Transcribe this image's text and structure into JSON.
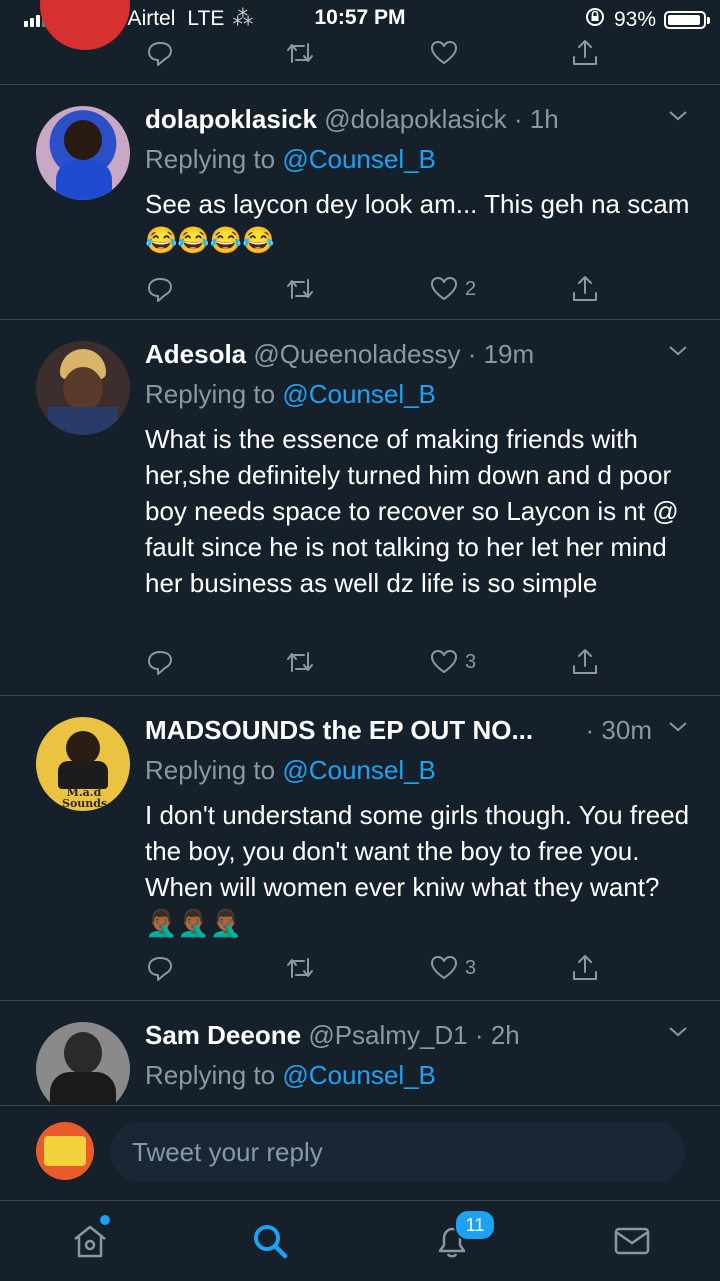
{
  "status_bar": {
    "carrier": "BeSafe Airtel",
    "network": "LTE",
    "time": "10:57 PM",
    "battery": "93%",
    "battery_level": 0.93
  },
  "tweets": [
    {
      "name": "dolapoklasick",
      "handle": "@dolapoklasick",
      "time": "· 1h",
      "replying_prefix": "Replying to",
      "replying_to": "@Counsel_B",
      "text": "See as laycon dey look am... This geh na scam 😂😂😂😂",
      "likes": "2"
    },
    {
      "name": "Adesola",
      "handle": "@Queenoladessy",
      "time": "· 19m",
      "replying_prefix": "Replying to",
      "replying_to": "@Counsel_B",
      "text": "What is the essence of making friends with her,she definitely turned him down and d poor boy needs space to recover so Laycon is nt @ fault since he is not talking to her let her mind her business as well dz life is so simple",
      "likes": "3"
    },
    {
      "name": "MADSOUNDS the EP OUT NO...",
      "handle": "",
      "time": "· 30m",
      "replying_prefix": "Replying to",
      "replying_to": "@Counsel_B",
      "text": "I don't understand some girls though. You freed the boy, you don't want the boy to free you. When will women ever kniw what they want?🤦🏾‍♂️🤦🏾‍♂️🤦🏾‍♂️",
      "likes": "3"
    },
    {
      "name": "Sam Deeone",
      "handle": "@Psalmy_D1",
      "time": "· 2h",
      "replying_prefix": "Replying to",
      "replying_to": "@Counsel_B"
    }
  ],
  "compose": {
    "placeholder": "Tweet your reply"
  },
  "tab_bar": {
    "notifications_count": "11"
  },
  "colors": {
    "background": "#15202b",
    "accent": "#1da1f2",
    "secondary_text": "#8899a6",
    "divider": "#38444d"
  }
}
